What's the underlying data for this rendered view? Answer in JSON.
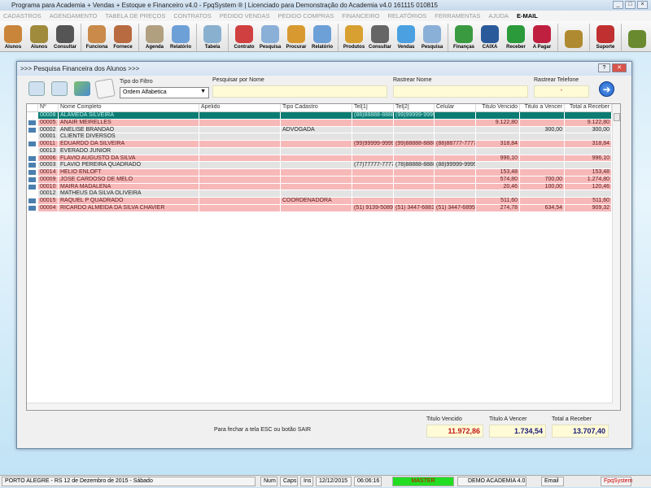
{
  "window": {
    "title": "Programa para Academia + Vendas + Estoque e Financeiro v4.0 - FpqSystem ® | Licenciado para  Demonstração do Academia v4.0 161115 010815"
  },
  "menu": [
    "CADASTROS",
    "AGENDAMENTO",
    "TABELA DE PREÇOS",
    "CONTRATOS",
    "PEDIDO VENDAS",
    "PEDIDO COMPRAS",
    "FINANCEIRO",
    "RELATÓRIOS",
    "FERRAMENTAS",
    "AJUDA"
  ],
  "menu_email": "E-MAIL",
  "toolbar": [
    {
      "label": "Alunos",
      "color": "#c9853a"
    },
    {
      "label": "Alunos",
      "color": "#a08a3c"
    },
    {
      "label": "Consultar",
      "color": "#555"
    },
    "sep",
    {
      "label": "Funciona",
      "color": "#c98a4a"
    },
    {
      "label": "Fornece",
      "color": "#b86a40"
    },
    "sep",
    {
      "label": "Agenda",
      "color": "#b0a080"
    },
    {
      "label": "Relatório",
      "color": "#6ea0d8"
    },
    "sep",
    {
      "label": "Tabela",
      "color": "#8ab0d0"
    },
    "sep",
    {
      "label": "Contrato",
      "color": "#d04040"
    },
    {
      "label": "Pesquisa",
      "color": "#8ab0d8"
    },
    {
      "label": "Procurar",
      "color": "#d89a30"
    },
    {
      "label": "Relatório",
      "color": "#6ea0d8"
    },
    "sep",
    {
      "label": "Produtos",
      "color": "#d8a030"
    },
    {
      "label": "Consultar",
      "color": "#666"
    },
    {
      "label": "Vendas",
      "color": "#4aa0e0"
    },
    {
      "label": "Pesquisa",
      "color": "#8ab0d8"
    },
    "sep",
    {
      "label": "Finanças",
      "color": "#3a9a40"
    },
    {
      "label": "CAIXA",
      "color": "#2a5a9a"
    },
    {
      "label": "Receber",
      "color": "#2a9a3a"
    },
    {
      "label": "A Pagar",
      "color": "#c02040"
    },
    "sep",
    {
      "label": "",
      "color": "#b08a30"
    },
    "sep",
    {
      "label": "Suporte",
      "color": "#c03030"
    },
    "sep",
    {
      "label": "",
      "color": "#6a8a30"
    }
  ],
  "dialog": {
    "title": ">>> Pesquisa Financeira dos Alunos >>>",
    "filter_label": "Tipo do Filtro",
    "filter_value": "Ordem Alfabetica",
    "search_name_label": "Pesquisar por Nome",
    "search_name_value": "",
    "track_name_label": "Rastrear Nome",
    "track_name_value": "",
    "track_phone_label": "Rastrear Telefone",
    "track_phone_value": "-",
    "columns": [
      "",
      "Nº",
      "Nome Completo",
      "Apelido",
      "Tipo Cadastro",
      "Tel[1]",
      "Tel[2]",
      "Celular",
      "Titulo Vencido",
      "Titulo a Vencer",
      "Total a Receber"
    ],
    "rows": [
      {
        "icon": false,
        "style": "sel",
        "cells": [
          "00008",
          "ALAMEDA SILVEIRA",
          "",
          "",
          "(88)88888-8888",
          "(99)99999-9999",
          "",
          "",
          "",
          ""
        ]
      },
      {
        "icon": true,
        "style": "pink",
        "cells": [
          "00005",
          "ANAIR MEIRELLES",
          "",
          "",
          "",
          "",
          "",
          "9.122,80",
          "",
          "9.122,80"
        ]
      },
      {
        "icon": true,
        "style": "gray",
        "cells": [
          "00002",
          "ANELISE BRANDÃO",
          "",
          "ADVOGADA",
          "",
          "",
          "",
          "",
          "300,00",
          "300,00"
        ]
      },
      {
        "icon": false,
        "style": "gray",
        "cells": [
          "00001",
          "CLIENTE DIVERSOS",
          "",
          "",
          "",
          "",
          "",
          "",
          "",
          ""
        ]
      },
      {
        "icon": true,
        "style": "pink",
        "cells": [
          "00011",
          "EDUARDO DA SILVEIRA",
          "",
          "",
          "(99)99999-9999",
          "(99)88888-8888",
          "(88)88777-7777",
          "318,84",
          "",
          "318,84"
        ]
      },
      {
        "icon": false,
        "style": "gray",
        "cells": [
          "00013",
          "EVERADO JUNIOR",
          "",
          "",
          "",
          "",
          "",
          "",
          "",
          ""
        ]
      },
      {
        "icon": true,
        "style": "pink",
        "cells": [
          "00006",
          "FLAVIO AUGUSTO DA SILVA",
          "",
          "",
          "",
          "",
          "",
          "996,10",
          "",
          "996,10"
        ]
      },
      {
        "icon": true,
        "style": "gray",
        "cells": [
          "00003",
          "FLAVIO PEREIRA QUADRADO",
          "",
          "",
          "(77)77777-7777",
          "(78)88888-8888",
          "(88)99999-9999",
          "",
          "",
          ""
        ]
      },
      {
        "icon": true,
        "style": "pink",
        "cells": [
          "00014",
          "HELIO ENLOFT",
          "",
          "",
          "",
          "",
          "",
          "153,48",
          "",
          "153,48"
        ]
      },
      {
        "icon": true,
        "style": "pink",
        "cells": [
          "00009",
          "JOSE CARDOSO DE MELO",
          "",
          "",
          "",
          "",
          "",
          "574,80",
          "700,00",
          "1.274,80"
        ]
      },
      {
        "icon": true,
        "style": "pink",
        "cells": [
          "00010",
          "MAIRA MADALENA",
          "",
          "",
          "",
          "",
          "",
          "20,46",
          "100,00",
          "120,46"
        ]
      },
      {
        "icon": false,
        "style": "gray",
        "cells": [
          "00012",
          "MATHEUS DA SILVA OLIVEIRA",
          "",
          "",
          "",
          "",
          "",
          "",
          "",
          ""
        ]
      },
      {
        "icon": true,
        "style": "pink",
        "cells": [
          "00015",
          "RAQUEL P QUADRADO",
          "",
          "COORDENADORA",
          "",
          "",
          "",
          "511,60",
          "",
          "511,60"
        ]
      },
      {
        "icon": true,
        "style": "pink",
        "cells": [
          "00004",
          "RICARDO ALMEIDA DA SILVA CHAVIER",
          "",
          "",
          "(51) 9139-5089",
          "(51) 3447-6881",
          "(51) 3447-6895",
          "274,78",
          "634,54",
          "909,32"
        ]
      }
    ],
    "close_hint": "Para fechar a tela ESC ou botão SAIR",
    "totals": {
      "vencido_label": "Titulo Vencido",
      "vencido": "11.972,86",
      "avencer_label": "Titulo A Vencer",
      "avencer": "1.734,54",
      "receber_label": "Total a Receber",
      "receber": "13.707,40"
    }
  },
  "status": {
    "location": "PORTO ALEGRE - RS 12 de Dezembro de 2015 - Sábado",
    "num": "Num",
    "caps": "Caps",
    "ins": "Ins",
    "date": "12/12/2015",
    "time": "06:06:16",
    "user": "MASTER",
    "company": "DEMO ACADEMIA 4.0",
    "email": "Email",
    "brand": "FpqSystem"
  }
}
